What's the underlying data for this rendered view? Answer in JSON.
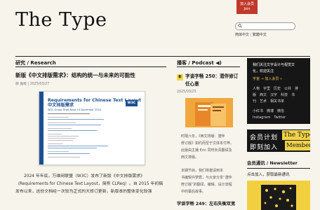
{
  "site": {
    "title": "The Type"
  },
  "header": {
    "join_line1": "加入会员",
    "join_line2": "Join",
    "lang_simplified": "简体中文",
    "lang_sep": "|",
    "lang_traditional": "繁體中文"
  },
  "research": {
    "section_title": "研究 / Research",
    "article_title": "新版《中文排版需求》：结构的统一与未来的可能性",
    "meta": "薛 嘉桦 | 2025/03/27",
    "doc": {
      "title_en": "Requirements for Chinese Text Layout",
      "title_zh": "中文排版需求",
      "subtitle": "W3C Group Draft Note 19 December 2024",
      "badge": "W3C"
    },
    "body_lines": [
      "2024 年年底，万维网联盟（W3C）发布了新版《中文排版需求》",
      "（Requirements for Chinese Text Layout，简称 CLReq）。自 2015 年初稿",
      "发布以来，这份文档经一次较为正式的大修订更新，新版本的整体变化较强"
    ]
  },
  "podcast": {
    "section_title": "播客 / Podcast ◀)",
    "badge": "新",
    "episode_title": "字谈字畅 250：潜伴修订任心意",
    "date": "2025/03/25",
    "desc_lines_1": [
      "时隔六年，《西文排版：潜伴",
      "修订版》如约而至于文体本付梓。",
      "此版由主播 Eric 同时负责翻译及",
      "西文排版。"
    ],
    "desc_lines_2": [
      "本期节目，我们将邀请到本",
      "书编辑许梦宸，与大家分享“潜伴",
      "修订版”的翻译、编辑、设计流程",
      "中的幕后故事。"
    ],
    "next_episode_title": "字谈字畅 249：左右失衡双宽"
  },
  "sidebar": {
    "intro_line1": "我们关注文字设计与视觉文",
    "intro_line2": "化，欢迎关注",
    "join_link": "宇宙 → 加入会员 »",
    "tags_line1": "人物　字里　历史　公共　排",
    "tags_line2": "版　西文　汉字　科技　书",
    "tags_line3": "刊　艺术　相关书单",
    "social_line1": "小红书　微博　微信",
    "social_line2": "Instagram　Twitter",
    "promo_line1": "会员计划",
    "promo_line2": "即刻加入",
    "promo_brand1": "The Type",
    "promo_brand2": "Members"
  },
  "newsletter": {
    "section_title": "会员通讯 / Newsletter",
    "desc": "点击加入，获取最新通讯"
  },
  "colors": {
    "accent_red": "#c0392b",
    "accent_yellow": "#f0d24a",
    "doc_blue": "#1d4f91",
    "podcast_orange": "#f0a83c"
  }
}
